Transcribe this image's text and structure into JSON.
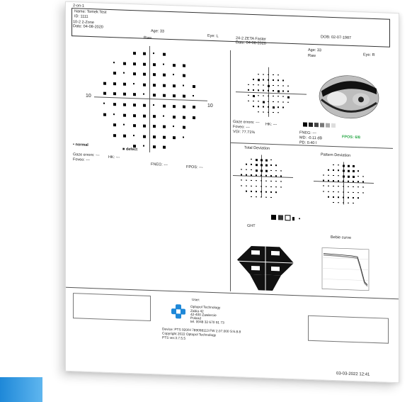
{
  "header": {
    "mode": "2-on-1",
    "name": "Name: Tomek Test",
    "id": "ID: 1111",
    "dob": "DOB: 02-07-1987"
  },
  "left_exam": {
    "program": "10-2 2-Zone",
    "date": "Date: 04-08-2020",
    "age": "Age: 33",
    "eye": "Eye: L",
    "plot_title": "Raw",
    "axis_left": "10",
    "axis_right": "10",
    "legend_normal": "normal",
    "legend_defect": "defect",
    "gaze_errors": "Gaze errors: ---",
    "hk": "HK: ---",
    "foveo": "Foveo: ---",
    "fneg": "FNEG: ---",
    "fpos": "FPOS: ---"
  },
  "right_exam": {
    "program": "24-2 ZETA Faster",
    "date": "Date: 04-08-2020",
    "age": "Age: 33",
    "eye": "Eye: R",
    "plot_title": "Raw",
    "gaze_errors": "Gaze errors: ---",
    "hk": "HK: ---",
    "foveo": "Foveo: ---",
    "vgi": "VGI: 77.71%",
    "fneg": "FNEG: ---",
    "md": "MD: -0.11 dB",
    "pd": "PD: 0.40 l",
    "fpos": "FPOS: 6/8",
    "total_deviation": "Total Deviation",
    "pattern_deviation": "Pattern Deviation",
    "ght": "GHT",
    "bebie": "Bebie curve"
  },
  "footer": {
    "user": "User:",
    "company": "Optopol Technology",
    "addr1": "Zabia 42",
    "addr2": "42-400 Zawiercie",
    "addr3": "Poland",
    "tel": "tel. 0048 32 670 91 73",
    "device": "Device: PTS 920/H 789098113 FW 2.07.000 S:6.8.8",
    "copyright": "Copyright 2022 Optopol Technology",
    "version": "PTS ver.3.7.5.5",
    "timestamp": "03-03-2022 12:41"
  },
  "colors": {
    "accent": "#1e88d8",
    "fpos_green": "#27a745"
  }
}
